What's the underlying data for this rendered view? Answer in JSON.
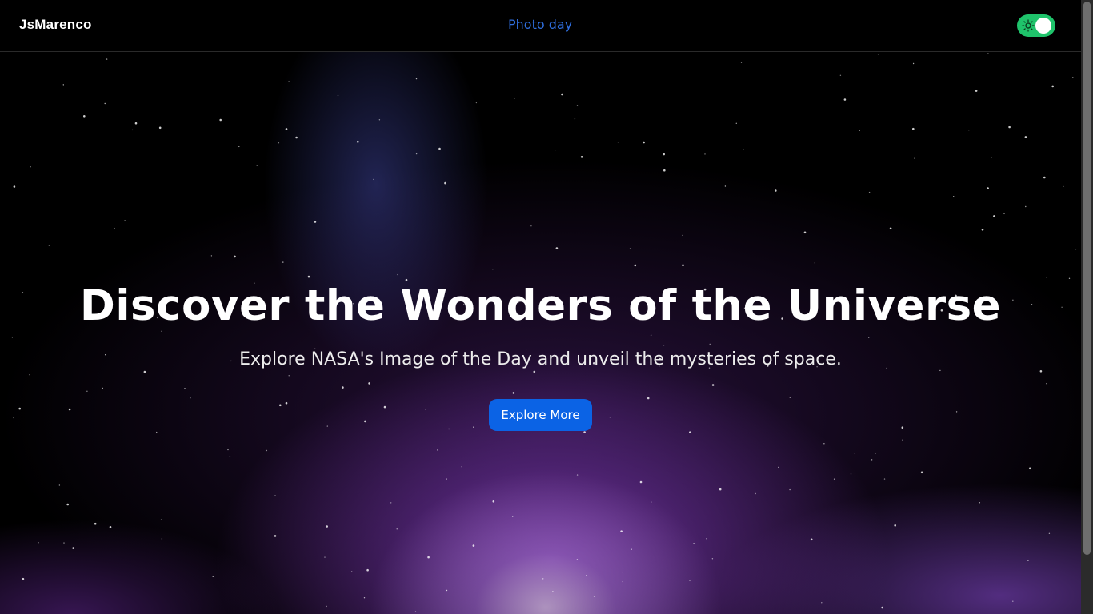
{
  "navbar": {
    "brand": "JsMarenco",
    "link_label": "Photo day",
    "theme_toggle": {
      "state": "on",
      "icon": "sun-icon",
      "color": "#1fc36b"
    }
  },
  "hero": {
    "title": "Discover the Wonders of the Universe",
    "subtitle": "Explore NASA's Image of the Day and unveil the mysteries of space.",
    "cta_label": "Explore More",
    "cta_color": "#0b63e5"
  },
  "theme": {
    "background": "#000000",
    "link_color": "#2f6fe0",
    "nebula_purple": "#8a3fc0",
    "nebula_blue": "#3c4196"
  }
}
